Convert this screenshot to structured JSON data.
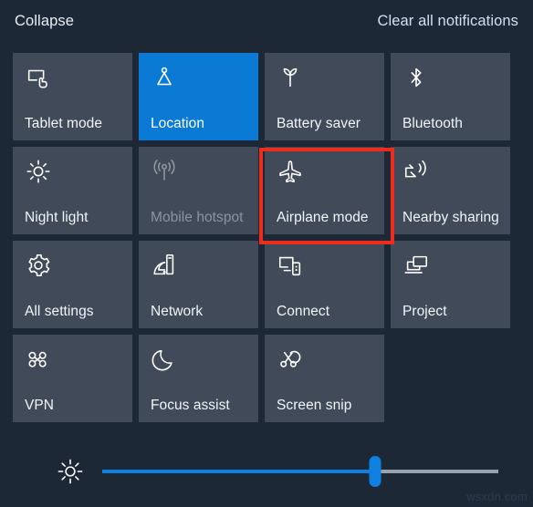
{
  "header": {
    "collapse_label": "Collapse",
    "clear_all_label": "Clear all notifications"
  },
  "colors": {
    "background": "#1d2837",
    "tile": "#404a58",
    "tile_active": "#0a7ad4",
    "accent": "#1080e0",
    "highlight_box": "#ee2b1c",
    "text": "#f2f5f9"
  },
  "quick_actions": {
    "tiles": [
      {
        "label": "Tablet mode",
        "icon": "tablet-mode-icon",
        "state": "off"
      },
      {
        "label": "Location",
        "icon": "location-icon",
        "state": "on"
      },
      {
        "label": "Battery saver",
        "icon": "battery-saver-icon",
        "state": "off"
      },
      {
        "label": "Bluetooth",
        "icon": "bluetooth-icon",
        "state": "off"
      },
      {
        "label": "Night light",
        "icon": "night-light-icon",
        "state": "off"
      },
      {
        "label": "Mobile hotspot",
        "icon": "mobile-hotspot-icon",
        "state": "disabled"
      },
      {
        "label": "Airplane mode",
        "icon": "airplane-icon",
        "state": "off"
      },
      {
        "label": "Nearby sharing",
        "icon": "nearby-sharing-icon",
        "state": "off"
      },
      {
        "label": "All settings",
        "icon": "gear-icon",
        "state": "off"
      },
      {
        "label": "Network",
        "icon": "network-icon",
        "state": "off"
      },
      {
        "label": "Connect",
        "icon": "connect-icon",
        "state": "off"
      },
      {
        "label": "Project",
        "icon": "project-icon",
        "state": "off"
      },
      {
        "label": "VPN",
        "icon": "vpn-icon",
        "state": "off"
      },
      {
        "label": "Focus assist",
        "icon": "moon-icon",
        "state": "off"
      },
      {
        "label": "Screen snip",
        "icon": "screen-snip-icon",
        "state": "off"
      }
    ]
  },
  "highlight": {
    "target_label": "Airplane mode"
  },
  "brightness": {
    "icon": "brightness-icon",
    "value_percent": 69
  },
  "watermark": {
    "text": "wsxdn.com"
  }
}
